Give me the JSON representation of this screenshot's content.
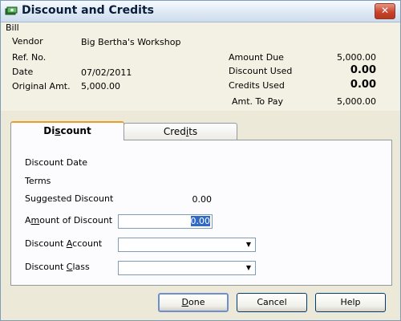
{
  "window": {
    "title": "Discount and Credits",
    "close_glyph": "✕"
  },
  "bill": {
    "section_label": "Bill",
    "vendor_label": "Vendor",
    "vendor_value": "Big Bertha's Workshop",
    "ref_no_label": "Ref. No.",
    "ref_no_value": "",
    "date_label": "Date",
    "date_value": "07/02/2011",
    "original_amt_label": "Original Amt.",
    "original_amt_value": "5,000.00",
    "amount_due_label": "Amount Due",
    "amount_due_value": "5,000.00",
    "discount_used_label": "Discount Used",
    "discount_used_value": "0.00",
    "credits_used_label": "Credits Used",
    "credits_used_value": "0.00",
    "amt_to_pay_label": "Amt. To Pay",
    "amt_to_pay_value": "5,000.00"
  },
  "tabs": {
    "discount": {
      "pre": "Di",
      "mnemonic": "s",
      "post": "count"
    },
    "credits": {
      "pre": "Cred",
      "mnemonic": "i",
      "post": "ts"
    }
  },
  "discount_panel": {
    "discount_date_label": "Discount Date",
    "terms_label": "Terms",
    "suggested_discount_label": "Suggested Discount",
    "suggested_discount_value": "0.00",
    "amount_label": {
      "pre": "A",
      "mnemonic": "m",
      "post": "ount of Discount"
    },
    "amount_value": "0.00",
    "account_label": {
      "pre": "Discount ",
      "mnemonic": "A",
      "post": "ccount"
    },
    "account_value": "",
    "class_label": {
      "pre": "Discount ",
      "mnemonic": "C",
      "post": "lass"
    },
    "class_value": ""
  },
  "buttons": {
    "done": {
      "pre": "",
      "mnemonic": "D",
      "post": "one"
    },
    "cancel": "Cancel",
    "help": "Help"
  },
  "icons": {
    "app_icon": "quickbooks-bill-icon",
    "dropdown_arrow": "▼"
  }
}
